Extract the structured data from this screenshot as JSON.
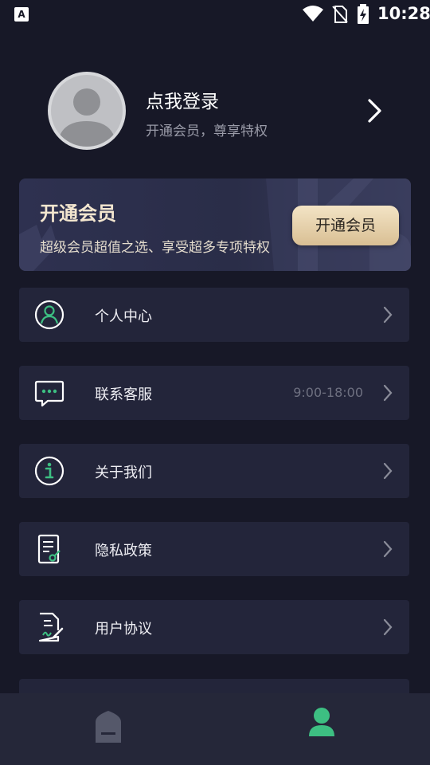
{
  "status_bar": {
    "time": "10:28",
    "notification_icon": "A",
    "icons": [
      "wifi-icon",
      "no-sim-icon",
      "battery-charging-icon"
    ]
  },
  "profile": {
    "title": "点我登录",
    "subtitle": "开通会员，尊享特权",
    "avatar_icon": "default-user-avatar"
  },
  "vip_banner": {
    "title": "开通会员",
    "subtitle": "超级会员超值之选、享受超多专项特权",
    "button_label": "开通会员"
  },
  "menu": {
    "items": [
      {
        "label": "个人中心",
        "icon": "user-circle-icon",
        "hint": ""
      },
      {
        "label": "联系客服",
        "icon": "chat-bubble-icon",
        "hint": "9:00-18:00"
      },
      {
        "label": "关于我们",
        "icon": "info-icon",
        "hint": ""
      },
      {
        "label": "隐私政策",
        "icon": "privacy-document-icon",
        "hint": ""
      },
      {
        "label": "用户协议",
        "icon": "agreement-document-icon",
        "hint": ""
      }
    ]
  },
  "bottom_nav": {
    "tabs": [
      {
        "name": "home",
        "icon": "home-icon",
        "active": false
      },
      {
        "name": "mine",
        "icon": "person-icon",
        "active": true
      }
    ]
  },
  "colors": {
    "background": "#171827",
    "card": "#23253a",
    "accent_green": "#3dbf82",
    "gold_button": "#e8d3ad"
  }
}
